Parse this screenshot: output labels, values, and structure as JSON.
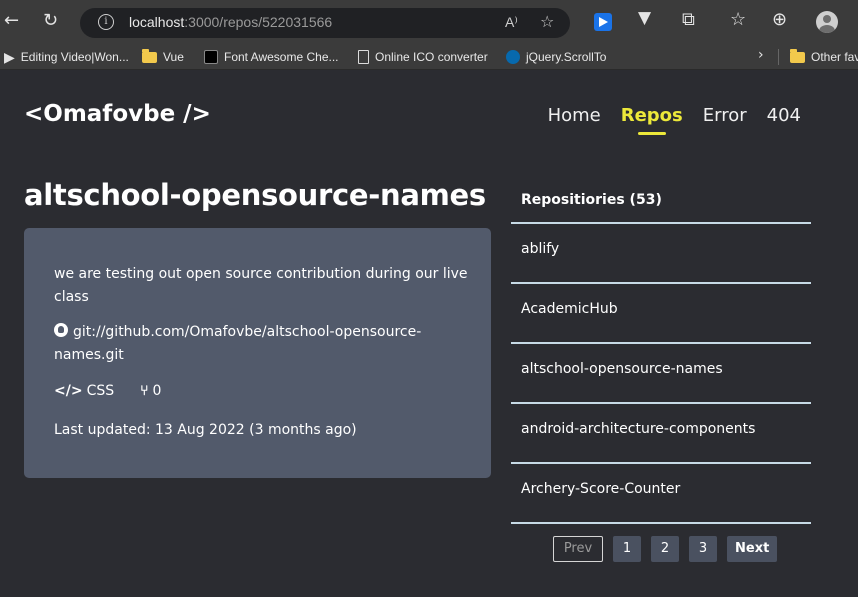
{
  "browser": {
    "url_host": "localhost",
    "url_path": ":3000/repos/522031566",
    "readaloud": "A⁾",
    "bookmarks": [
      {
        "label": "Editing Video|Won..."
      },
      {
        "label": "Vue"
      },
      {
        "label": "Font Awesome Che..."
      },
      {
        "label": "Online ICO converter"
      },
      {
        "label": "jQuery.ScrollTo"
      },
      {
        "label": "Other fav"
      }
    ]
  },
  "header": {
    "logo": "<Omafovbe />",
    "nav": [
      {
        "label": "Home",
        "active": false
      },
      {
        "label": "Repos",
        "active": true
      },
      {
        "label": "Error",
        "active": false
      },
      {
        "label": "404",
        "active": false
      }
    ]
  },
  "repo": {
    "title": "altschool-opensource-names",
    "description": "we are testing out open source contribution during our live class",
    "git_url": "git://github.com/Omafovbe/altschool-opensource-names.git",
    "language_icon": "</>",
    "language": "CSS",
    "forks": "0",
    "last_updated": "Last updated: 13 Aug 2022 (3 months ago)"
  },
  "sidebar": {
    "heading": "Repositiories (53)",
    "items": [
      {
        "label": "ablify"
      },
      {
        "label": "AcademicHub"
      },
      {
        "label": "altschool-opensource-names"
      },
      {
        "label": "android-architecture-components"
      },
      {
        "label": "Archery-Score-Counter"
      }
    ]
  },
  "pagination": {
    "prev": "Prev",
    "pages": [
      "1",
      "2",
      "3"
    ],
    "next": "Next"
  }
}
